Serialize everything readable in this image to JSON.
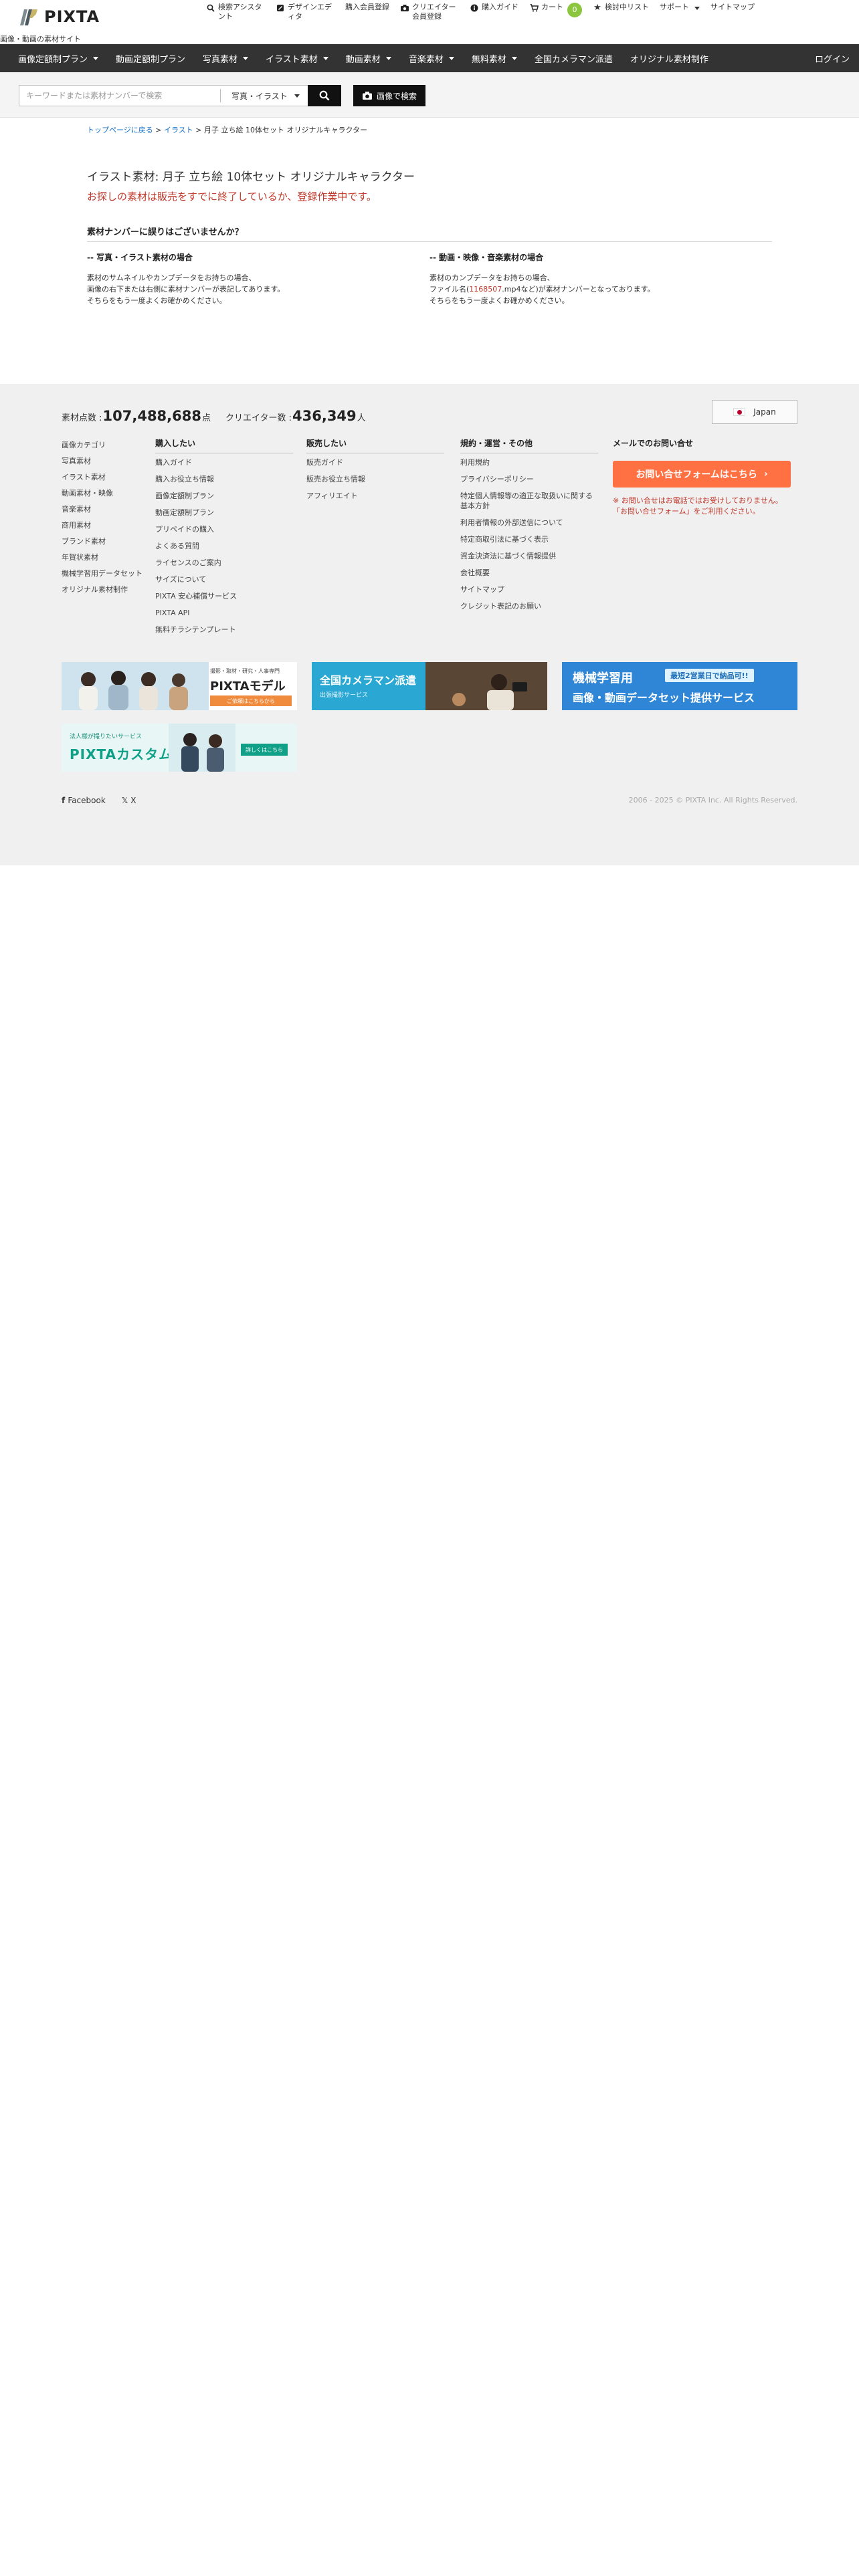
{
  "header": {
    "brand": "PIXTA",
    "tagline": "画像・動画の素材サイト",
    "nav": [
      {
        "icon": "search-icon",
        "label": "検索アシスタント"
      },
      {
        "icon": "design-editor-icon",
        "label": "デザインエディタ"
      },
      {
        "icon": "",
        "label": "購入会員登録"
      },
      {
        "icon": "camera-icon",
        "label": "クリエイター会員登録"
      },
      {
        "icon": "info-icon",
        "label": "購入ガイド"
      },
      {
        "icon": "cart-icon",
        "label": "カート",
        "badge": "0"
      },
      {
        "icon": "star-icon",
        "label": "検討中リスト"
      },
      {
        "icon": "",
        "label": "サポート"
      },
      {
        "icon": "",
        "label": "サイトマップ"
      }
    ]
  },
  "menu": {
    "items": [
      "画像定額制プラン",
      "動画定額制プラン",
      "写真素材",
      "イラスト素材",
      "動画素材",
      "音楽素材",
      "無料素材",
      "全国カメラマン派遣",
      "オリジナル素材制作"
    ],
    "login": "ログイン"
  },
  "search": {
    "placeholder": "キーワードまたは素材ナンバーで検索",
    "type": "写真・イラスト",
    "image_search": "画像で検索"
  },
  "breadcrumb": {
    "top": "トップページに戻る",
    "sep1": " > ",
    "category": "イラスト",
    "sep2": " > ",
    "current": "月子 立ち絵 10体セット オリジナルキャラクター"
  },
  "item": {
    "title": "イラスト素材: 月子 立ち絵 10体セット オリジナルキャラクター",
    "notice": "お探しの素材は販売をすでに終了しているか、登録作業中です。"
  },
  "help": {
    "title": "素材ナンバーに誤りはございませんか？",
    "photo": {
      "heading": "-- 写真・イラスト素材の場合",
      "lines": [
        "素材のサムネイルやカンプデータをお持ちの場合、",
        "画像の右下または右側に素材ナンバーが表記してあります。",
        "そちらをもう一度よくお確かめください。"
      ]
    },
    "video": {
      "heading": "-- 動画・映像・音楽素材の場合",
      "line1": "素材のカンプデータをお持ちの場合、",
      "line2_prefix": "ファイル名(",
      "line2_link": "1168507",
      "line2_suffix": ".mp4など)が素材ナンバーとなっております。",
      "line3": "そちらをもう一度よくお確かめください。"
    }
  },
  "footer": {
    "stats": {
      "count_label": "素材点数 : ",
      "count": "107,488,688",
      "count_unit": "点",
      "creator_label": "クリエイター数 : ",
      "creators": "436,349",
      "creators_unit": "人"
    },
    "language": "Japan",
    "categories": [
      "画像カテゴリ",
      "写真素材",
      "イラスト素材",
      "動画素材・映像",
      "音楽素材",
      "商用素材",
      "ブランド素材",
      "年賀状素材",
      "機械学習用データセット",
      "オリジナル素材制作"
    ],
    "buy": {
      "title": "購入したい",
      "links": [
        "購入ガイド",
        "購入お役立ち情報",
        "画像定額制プラン",
        "動画定額制プラン",
        "プリペイドの購入",
        "よくある質問",
        "ライセンスのご案内",
        "サイズについて",
        "PIXTA 安心補償サービス",
        "PIXTA API",
        "無料チラシテンプレート"
      ]
    },
    "sell": {
      "title": "販売したい",
      "links": [
        "販売ガイド",
        "販売お役立ち情報",
        "アフィリエイト"
      ]
    },
    "terms": {
      "title": "規約・運営・その他",
      "links": [
        "利用規約",
        "プライバシーポリシー",
        "特定個人情報等の適正な取扱いに関する基本方針",
        "利用者情報の外部送信について",
        "特定商取引法に基づく表示",
        "資金決済法に基づく情報提供",
        "会社概要",
        "サイトマップ",
        "クレジット表記のお願い"
      ]
    },
    "contact": {
      "title": "メールでのお問い合せ",
      "button": "お問い合せフォームはこちら",
      "note": "※ お問い合せはお電話ではお受けしておりません。「お問い合せフォーム」をご利用ください。"
    },
    "banners": {
      "model": {
        "sub": "撮影・取材・研究・人事専門",
        "title": "PIXTAモデル",
        "cta": "ご依頼はこちらから"
      },
      "camera": {
        "title": "全国カメラマン派遣",
        "sub": "出張撮影サービス"
      },
      "ml": {
        "line1": "機械学習用",
        "badge": "最短2営業日で納品可!!",
        "line2": "画像・動画データセット提供サービス"
      },
      "custom": {
        "sub": "法人様が撮りたいサービス",
        "title": "PIXTAカスタム",
        "cta": "詳しくはこちら"
      }
    },
    "social": [
      "Facebook",
      "X"
    ],
    "copyright": "2006 - 2025 © PIXTA Inc. All Rights Reserved."
  }
}
